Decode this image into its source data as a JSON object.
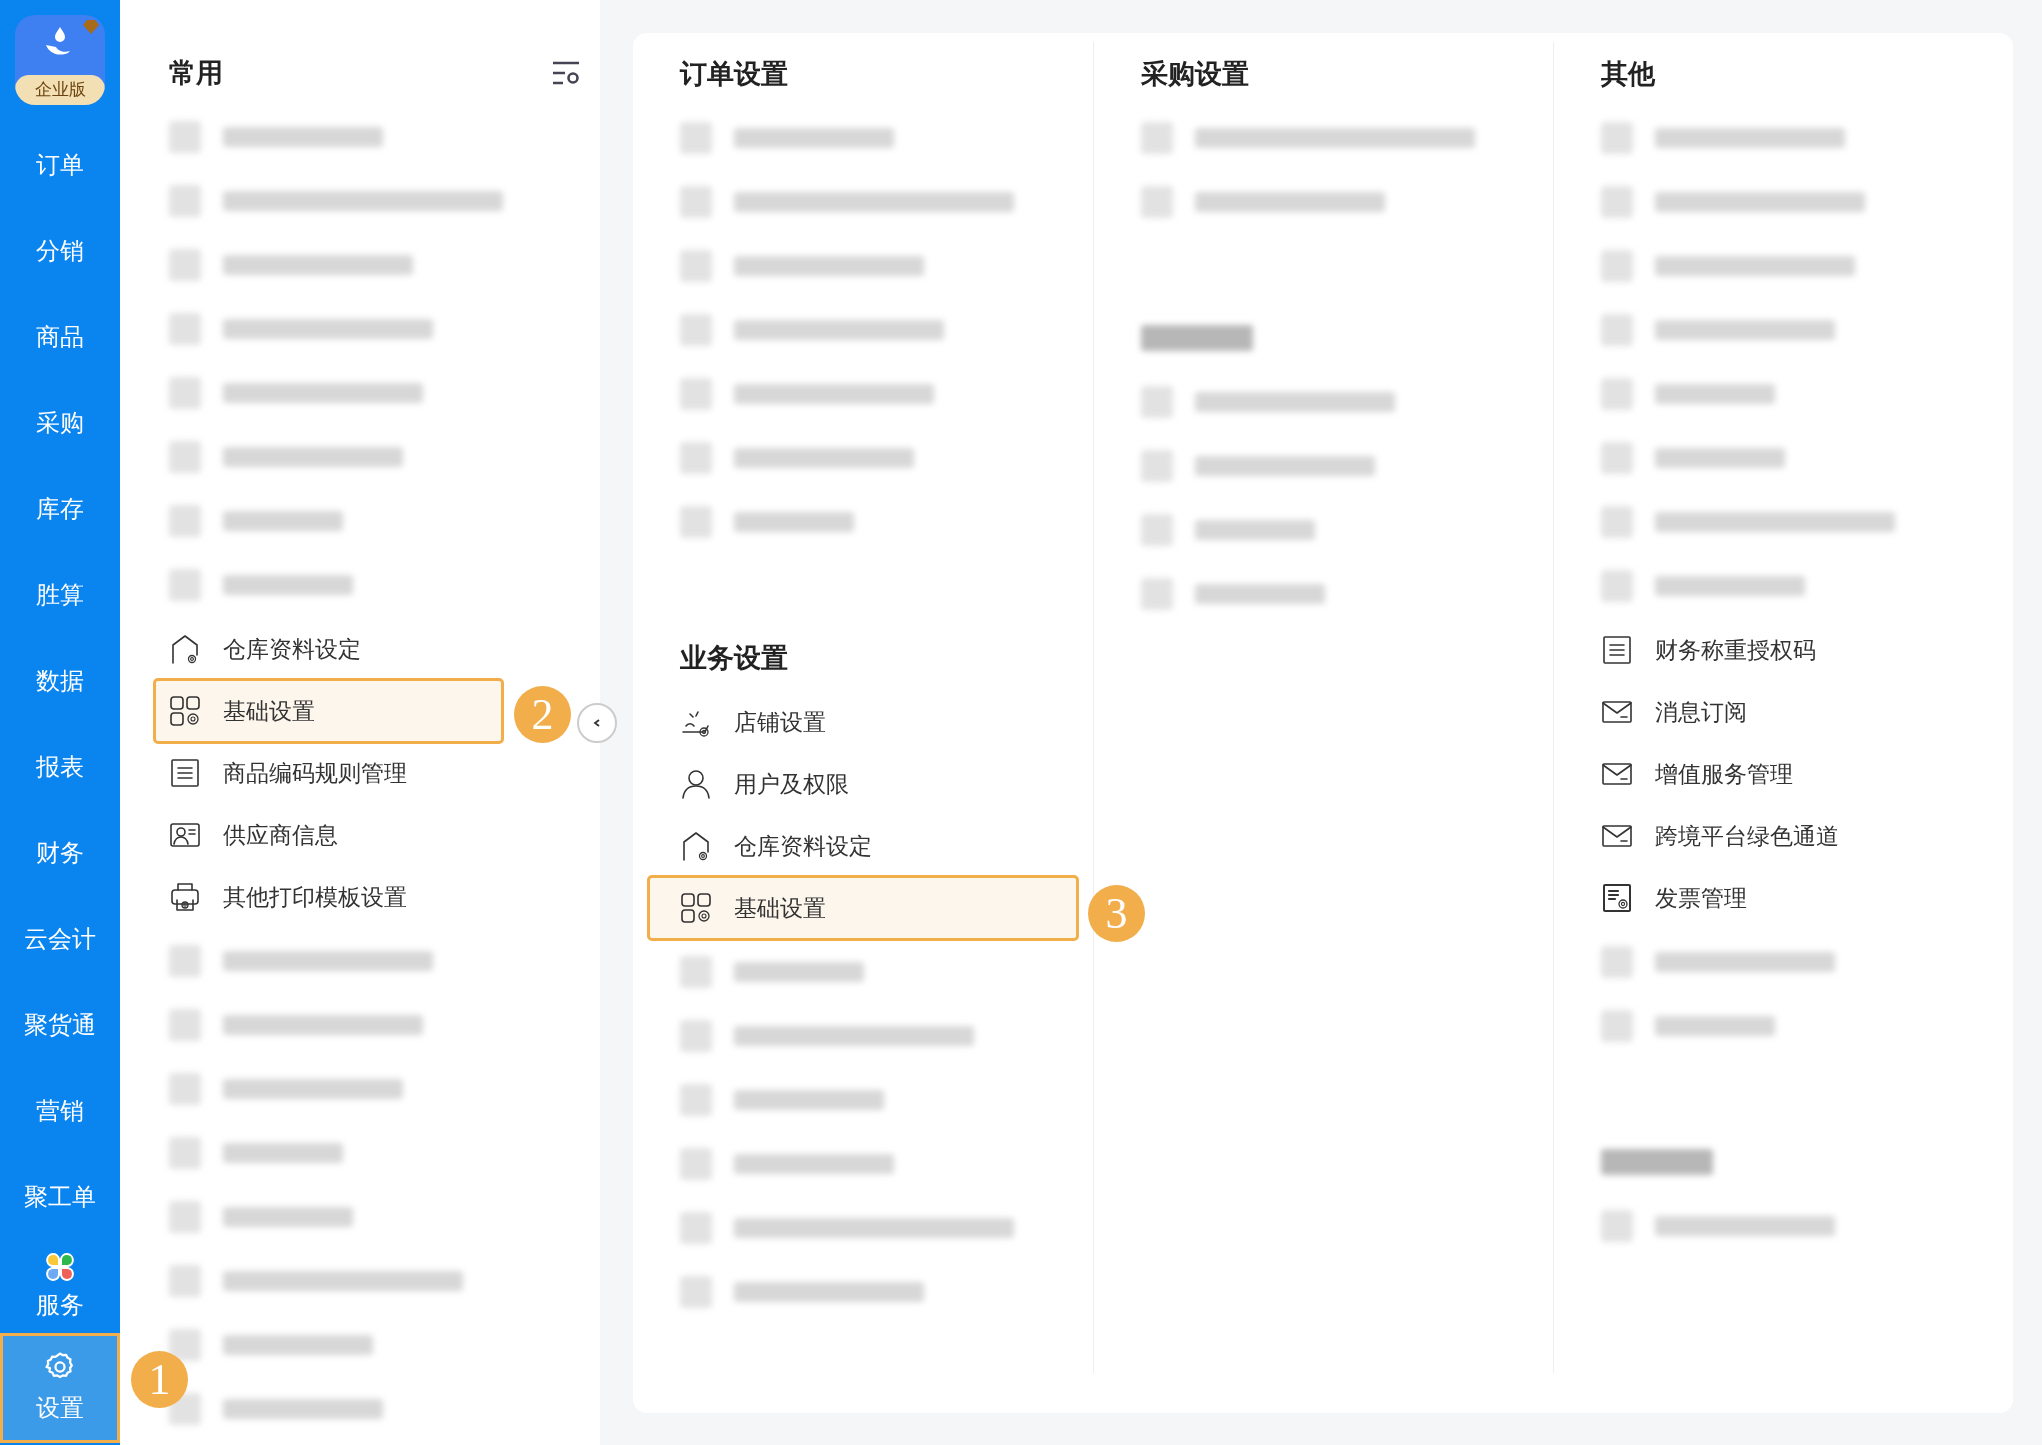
{
  "sidebar": {
    "logo": {
      "badge": "企业版"
    },
    "items": [
      {
        "kind": "text",
        "label": "订单",
        "selected": false
      },
      {
        "kind": "text",
        "label": "分销",
        "selected": false
      },
      {
        "kind": "text",
        "label": "商品",
        "selected": false
      },
      {
        "kind": "text",
        "label": "采购",
        "selected": false
      },
      {
        "kind": "text",
        "label": "库存",
        "selected": false
      },
      {
        "kind": "text",
        "label": "胜算",
        "selected": false
      },
      {
        "kind": "text",
        "label": "数据",
        "selected": false
      },
      {
        "kind": "text",
        "label": "报表",
        "selected": false
      },
      {
        "kind": "text",
        "label": "财务",
        "selected": false
      },
      {
        "kind": "text",
        "label": "云会计",
        "selected": false
      },
      {
        "kind": "text",
        "label": "聚货通",
        "selected": false
      },
      {
        "kind": "text",
        "label": "营销",
        "selected": false
      },
      {
        "kind": "text",
        "label": "聚工单",
        "selected": false
      },
      {
        "kind": "services",
        "label": "服务",
        "selected": false
      },
      {
        "kind": "settings",
        "label": "设置",
        "selected": true
      }
    ]
  },
  "common_panel": {
    "title": "常用",
    "items": [
      {
        "kind": "blurred"
      },
      {
        "kind": "blurred"
      },
      {
        "kind": "blurred"
      },
      {
        "kind": "blurred"
      },
      {
        "kind": "blurred"
      },
      {
        "kind": "blurred"
      },
      {
        "kind": "blurred"
      },
      {
        "kind": "blurred"
      },
      {
        "kind": "item",
        "label": "仓库资料设定",
        "selected": false
      },
      {
        "kind": "item",
        "label": "基础设置",
        "selected": true
      },
      {
        "kind": "item",
        "label": "商品编码规则管理",
        "selected": false
      },
      {
        "kind": "item",
        "label": "供应商信息",
        "selected": false
      },
      {
        "kind": "item",
        "label": "其他打印模板设置",
        "selected": false
      },
      {
        "kind": "blurred"
      },
      {
        "kind": "blurred"
      },
      {
        "kind": "blurred"
      },
      {
        "kind": "blurred"
      },
      {
        "kind": "blurred"
      },
      {
        "kind": "blurred"
      },
      {
        "kind": "blurred"
      },
      {
        "kind": "blurred"
      }
    ]
  },
  "settings_card": {
    "columns": [
      {
        "groups": [
          {
            "header": {
              "kind": "text",
              "text": "订单设置"
            },
            "items": [
              {
                "kind": "blurred"
              },
              {
                "kind": "blurred"
              },
              {
                "kind": "blurred"
              },
              {
                "kind": "blurred"
              },
              {
                "kind": "blurred"
              },
              {
                "kind": "blurred"
              },
              {
                "kind": "blurred"
              }
            ]
          },
          {
            "header": {
              "kind": "text",
              "text": "业务设置"
            },
            "items": [
              {
                "kind": "item",
                "label": "店铺设置",
                "selected": false
              },
              {
                "kind": "item",
                "label": "用户及权限",
                "selected": false
              },
              {
                "kind": "item",
                "label": "仓库资料设定",
                "selected": false
              },
              {
                "kind": "item",
                "label": "基础设置",
                "selected": true
              },
              {
                "kind": "blurred"
              },
              {
                "kind": "blurred"
              },
              {
                "kind": "blurred"
              },
              {
                "kind": "blurred"
              },
              {
                "kind": "blurred"
              },
              {
                "kind": "blurred"
              }
            ]
          }
        ]
      },
      {
        "groups": [
          {
            "header": {
              "kind": "text",
              "text": "采购设置"
            },
            "items": [
              {
                "kind": "blurred"
              },
              {
                "kind": "blurred"
              }
            ]
          },
          {
            "header": {
              "kind": "blurred"
            },
            "items": [
              {
                "kind": "blurred"
              },
              {
                "kind": "blurred"
              },
              {
                "kind": "blurred"
              },
              {
                "kind": "blurred"
              }
            ]
          }
        ]
      },
      {
        "groups": [
          {
            "header": {
              "kind": "text",
              "text": "其他"
            },
            "items": [
              {
                "kind": "blurred"
              },
              {
                "kind": "blurred"
              },
              {
                "kind": "blurred"
              },
              {
                "kind": "blurred"
              },
              {
                "kind": "blurred"
              },
              {
                "kind": "blurred"
              },
              {
                "kind": "blurred"
              },
              {
                "kind": "blurred"
              },
              {
                "kind": "item",
                "label": "财务称重授权码",
                "selected": false
              },
              {
                "kind": "item",
                "label": "消息订阅",
                "selected": false
              },
              {
                "kind": "item",
                "label": "增值服务管理",
                "selected": false
              },
              {
                "kind": "item",
                "label": "跨境平台绿色通道",
                "selected": false
              },
              {
                "kind": "item",
                "label": "发票管理",
                "selected": false
              },
              {
                "kind": "blurred"
              },
              {
                "kind": "blurred"
              }
            ]
          },
          {
            "header": {
              "kind": "blurred"
            },
            "items": [
              {
                "kind": "blurred"
              }
            ]
          }
        ]
      }
    ]
  },
  "annotations": [
    {
      "text": "1"
    },
    {
      "text": "2"
    },
    {
      "text": "3"
    }
  ]
}
